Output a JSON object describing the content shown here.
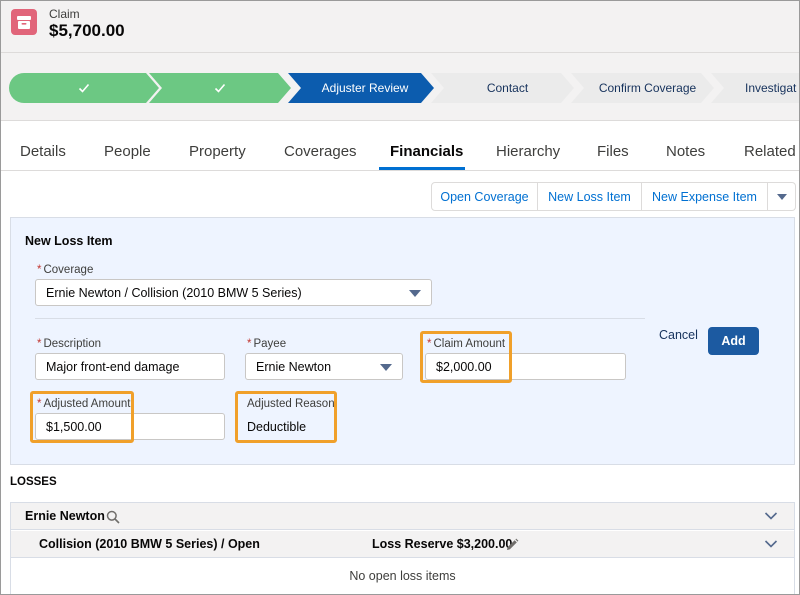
{
  "header": {
    "object_label": "Claim",
    "title": "$5,700.00",
    "icon": "archive-icon"
  },
  "path": {
    "steps": [
      {
        "label": "",
        "state": "complete"
      },
      {
        "label": "",
        "state": "complete"
      },
      {
        "label": "Adjuster Review",
        "state": "current"
      },
      {
        "label": "Contact",
        "state": "incomplete"
      },
      {
        "label": "Confirm Coverage",
        "state": "incomplete"
      },
      {
        "label": "Investigat",
        "state": "incomplete"
      }
    ]
  },
  "tabs": [
    "Details",
    "People",
    "Property",
    "Coverages",
    "Financials",
    "Hierarchy",
    "Files",
    "Notes",
    "Related"
  ],
  "active_tab": "Financials",
  "actions": {
    "open_coverage": "Open Coverage",
    "new_loss_item": "New Loss Item",
    "new_expense_item": "New Expense Item"
  },
  "form": {
    "title": "New Loss Item",
    "required_mark": "*",
    "coverage_label": "Coverage",
    "coverage_value": "Ernie Newton / Collision (2010 BMW 5 Series)",
    "description_label": "Description",
    "description_value": "Major front-end damage",
    "payee_label": "Payee",
    "payee_value": "Ernie Newton",
    "claim_amount_label": "Claim Amount",
    "claim_amount_value": "$2,000.00",
    "adjusted_amount_label": "Adjusted Amount",
    "adjusted_amount_value": "$1,500.00",
    "adjusted_reason_label": "Adjusted Reason",
    "adjusted_reason_value": "Deductible",
    "cancel_label": "Cancel",
    "add_label": "Add"
  },
  "losses": {
    "title": "LOSSES",
    "payee_name": "Ernie Newton",
    "coverage_line": "Collision (2010 BMW 5 Series) / Open",
    "loss_reserve": "Loss Reserve $3,200.00",
    "empty_message": "No open loss items"
  },
  "colors": {
    "complete": "#6cc883",
    "current": "#0c5cae",
    "incomplete": "#ebebeb",
    "highlight": "#f0a02a",
    "brand_button": "#1c5aa1",
    "header_icon": "#e1657a"
  }
}
